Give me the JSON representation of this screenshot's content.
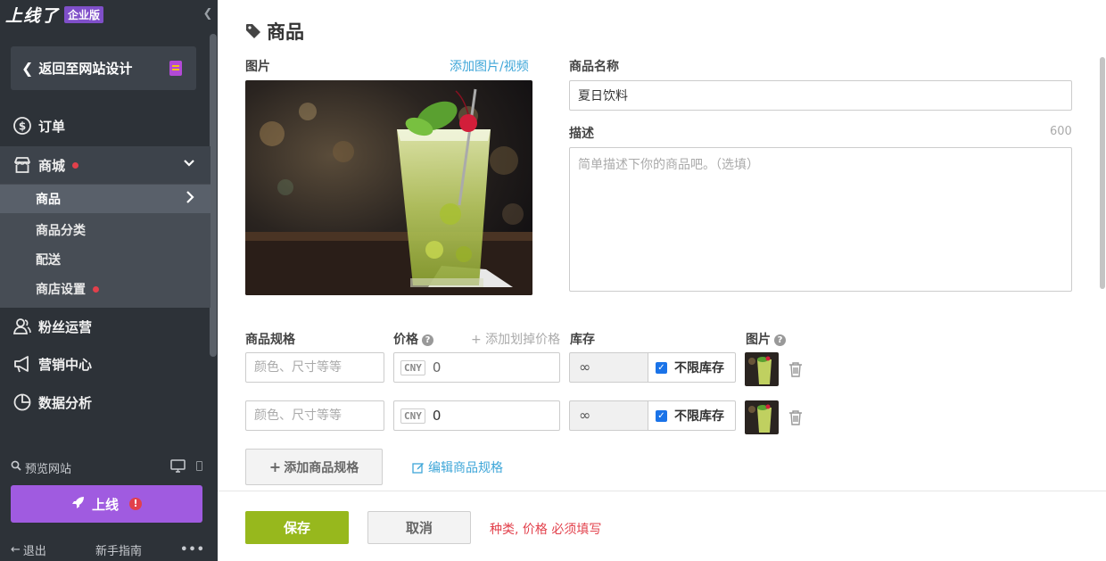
{
  "brand": {
    "logo": "上线了",
    "badge": "企业版"
  },
  "sidebar": {
    "back_label": "返回至网站设计",
    "nav": [
      {
        "label": "订单",
        "icon": "dollar-circle-icon"
      },
      {
        "label": "商城",
        "icon": "store-icon",
        "has_dot": true
      },
      {
        "label": "粉丝运营",
        "icon": "users-icon"
      },
      {
        "label": "营销中心",
        "icon": "megaphone-icon"
      },
      {
        "label": "数据分析",
        "icon": "pie-chart-icon"
      }
    ],
    "sub": [
      {
        "label": "商品",
        "active": true
      },
      {
        "label": "商品分类"
      },
      {
        "label": "配送"
      },
      {
        "label": "商店设置",
        "has_dot": true
      }
    ],
    "preview_label": "预览网站",
    "launch_label": "上线",
    "launch_warning": "!",
    "logout_label": "退出",
    "guide_label": "新手指南",
    "more_label": "•••"
  },
  "main": {
    "title": "商品",
    "image_label": "图片",
    "add_media_link": "添加图片/视频",
    "name_label": "商品名称",
    "name_value": "夏日饮料",
    "desc_label": "描述",
    "desc_counter": "600",
    "desc_placeholder": "简单描述下你的商品吧。（选填）",
    "spec_header": "商品规格",
    "price_header": "价格",
    "add_strike_price": "+ 添加划掉价格",
    "stock_header": "库存",
    "image_header": "图片",
    "variants": [
      {
        "spec_placeholder": "颜色、尺寸等等",
        "currency": "CNY",
        "price": "0",
        "stock": "∞",
        "unlimited_label": "不限库存",
        "unlimited_checked": true
      },
      {
        "spec_placeholder": "颜色、尺寸等等",
        "currency": "CNY",
        "price": "0",
        "stock": "∞",
        "unlimited_label": "不限库存",
        "unlimited_checked": true
      }
    ],
    "add_spec_button": "添加商品规格",
    "edit_spec_link": "编辑商品规格",
    "save_button": "保存",
    "cancel_button": "取消",
    "error_message": "种类, 价格 必须填写"
  },
  "colors": {
    "sidebar_bg": "#2d3238",
    "accent_purple": "#a05be0",
    "save_green": "#97b81d",
    "link_blue": "#3ea6d8",
    "error_red": "#e2404b"
  }
}
